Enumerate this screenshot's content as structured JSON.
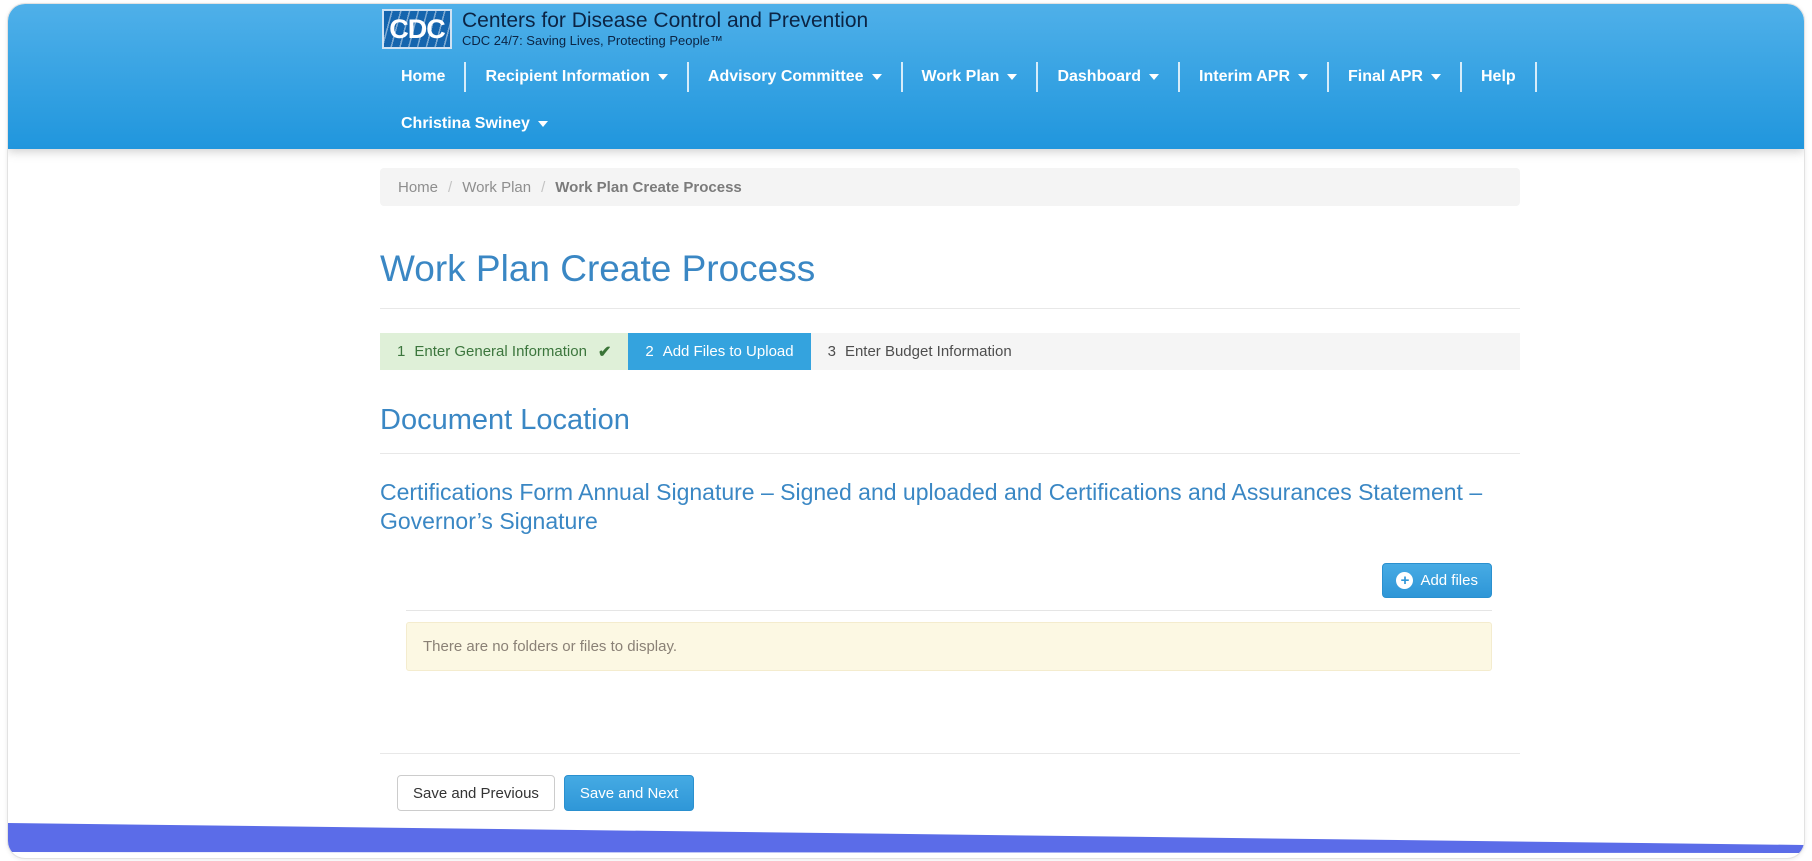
{
  "header": {
    "logo": {
      "acronym": "CDC",
      "title": "Centers for Disease Control and Prevention",
      "tagline": "CDC 24/7: Saving Lives, Protecting People™"
    },
    "nav": [
      {
        "label": "Home",
        "dropdown": false
      },
      {
        "label": "Recipient Information",
        "dropdown": true
      },
      {
        "label": "Advisory Committee",
        "dropdown": true
      },
      {
        "label": "Work Plan",
        "dropdown": true
      },
      {
        "label": "Dashboard",
        "dropdown": true
      },
      {
        "label": "Interim APR",
        "dropdown": true
      },
      {
        "label": "Final APR",
        "dropdown": true
      },
      {
        "label": "Help",
        "dropdown": false
      }
    ],
    "user": {
      "label": "Christina Swiney",
      "dropdown": true
    }
  },
  "breadcrumb": {
    "separator": "/",
    "links": [
      {
        "label": "Home"
      },
      {
        "label": "Work Plan"
      }
    ],
    "current": "Work Plan Create Process"
  },
  "page": {
    "title": "Work Plan Create Process"
  },
  "wizard": {
    "steps": [
      {
        "number": "1",
        "label": "Enter General Information",
        "state": "complete",
        "check": "✔"
      },
      {
        "number": "2",
        "label": "Add Files to Upload",
        "state": "active"
      },
      {
        "number": "3",
        "label": "Enter Budget Information",
        "state": "pending"
      }
    ]
  },
  "section": {
    "heading": "Document Location",
    "description": "Certifications Form Annual Signature – Signed and uploaded and Certifications and Assurances Statement – Governor’s Signature"
  },
  "upload": {
    "add_files_label": "Add files",
    "plus_glyph": "+",
    "empty_message": "There are no folders or files to display."
  },
  "footer_actions": {
    "previous_label": "Save and Previous",
    "next_label": "Save and Next"
  },
  "colors": {
    "header_gradient_top": "#4fb0e9",
    "header_gradient_bottom": "#2096dd",
    "brand_heading_blue": "#3a87c4",
    "active_step_blue": "#34a3de",
    "success_bg": "#dff0d8",
    "success_text": "#3c763d",
    "primary_button_blue": "#2f97d8",
    "warning_bg": "#fcf8e3",
    "warning_text": "#8a8176",
    "wedge_purple": "#5b6ce8"
  }
}
